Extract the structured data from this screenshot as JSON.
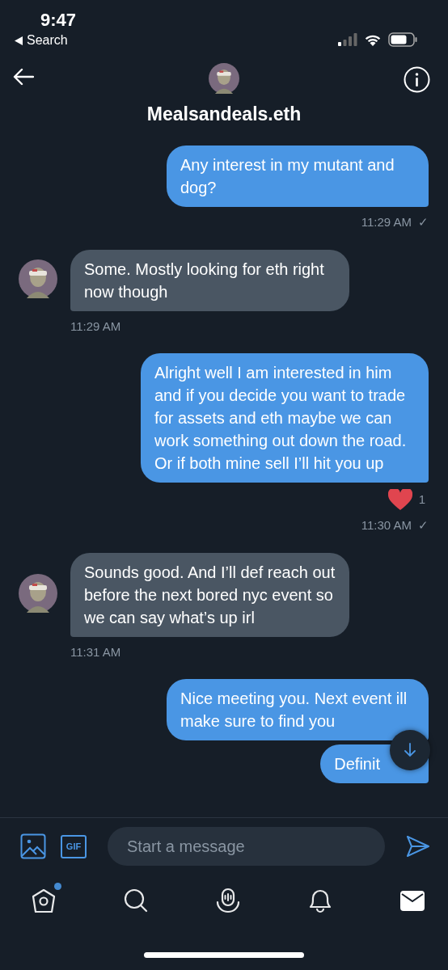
{
  "status_bar": {
    "time": "9:47",
    "back_label": "Search"
  },
  "header": {
    "title": "Mealsandeals.eth"
  },
  "messages": [
    {
      "kind": "sent",
      "text": "Any interest in my mutant and dog?",
      "time": "11:29 AM",
      "read_mark": "✓"
    },
    {
      "kind": "received",
      "text": "Some. Mostly looking for eth right now though",
      "time": "11:29 AM"
    },
    {
      "kind": "sent",
      "text": "Alright well I am interested in him and if you decide you want to trade for assets and eth maybe we can work something out down the road. Or if both mine sell I’ll hit you up",
      "reaction": {
        "count": "1"
      },
      "time": "11:30 AM",
      "read_mark": "✓"
    },
    {
      "kind": "received",
      "text": "Sounds good. And I’ll def reach out before the next bored nyc event so we can say what’s up irl",
      "time": "11:31 AM"
    },
    {
      "kind": "sent",
      "text": "Nice meeting you. Next event ill make sure to find you"
    },
    {
      "kind": "sent",
      "text": "Definit"
    }
  ],
  "composer": {
    "gif_label": "GIF",
    "placeholder": "Start a message"
  },
  "nav": [
    {
      "kind": "home",
      "selected": false,
      "badge": true
    },
    {
      "kind": "search",
      "selected": false
    },
    {
      "kind": "spaces",
      "selected": false
    },
    {
      "kind": "notifications",
      "selected": false
    },
    {
      "kind": "messages",
      "selected": true
    }
  ]
}
